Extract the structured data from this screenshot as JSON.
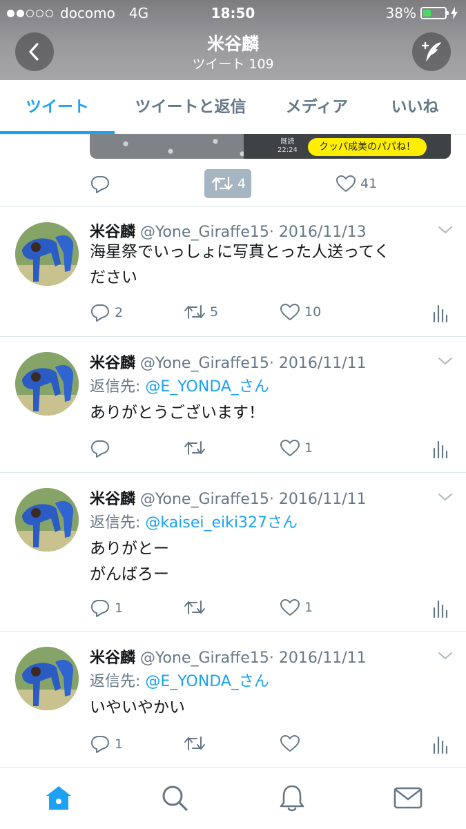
{
  "status_bar": {
    "carrier": "docomo",
    "network": "4G",
    "time": "18:50",
    "battery": "38%",
    "battery_level": 0.38
  },
  "header": {
    "name": "米谷麟",
    "tweet_count": "ツイート 109"
  },
  "tabs": [
    {
      "label": "ツイート",
      "active": true
    },
    {
      "label": "ツイートと返信"
    },
    {
      "label": "メディア"
    },
    {
      "label": "いいね"
    }
  ],
  "partial_tweet": {
    "image_read_mark": "既読",
    "image_time": "22:24",
    "image_bubble": "クッパ成美のパパね！",
    "retweets": "4",
    "likes": "41"
  },
  "tweets": [
    {
      "name": "米谷麟",
      "handle": "@Yone_Giraffe15",
      "date": "· 2016/11/13",
      "text_lines": [
        "海星祭でいっしょに写真とった人送ってく",
        "ださい"
      ],
      "replies": "2",
      "retweets": "5",
      "likes": "10"
    },
    {
      "name": "米谷麟",
      "handle": "@Yone_Giraffe15",
      "date": "· 2016/11/11",
      "reply_label": "返信先: ",
      "reply_handle": "@E_YONDA_さん",
      "text_lines": [
        "ありがとうございます！"
      ],
      "replies": "",
      "retweets": "",
      "likes": "1"
    },
    {
      "name": "米谷麟",
      "handle": "@Yone_Giraffe15",
      "date": "· 2016/11/11",
      "reply_label": "返信先: ",
      "reply_handle": "@kaisei_eiki327さん",
      "text_lines": [
        "ありがとー",
        "がんばろー"
      ],
      "replies": "1",
      "retweets": "",
      "likes": "1"
    },
    {
      "name": "米谷麟",
      "handle": "@Yone_Giraffe15",
      "date": "· 2016/11/11",
      "reply_label": "返信先: ",
      "reply_handle": "@E_YONDA_さん",
      "text_lines": [
        "いやいやかい"
      ],
      "replies": "1",
      "retweets": "",
      "likes": ""
    }
  ],
  "icons": {
    "back": "chevron-left-icon",
    "compose": "compose-icon",
    "reply": "reply-icon",
    "retweet": "retweet-icon",
    "like": "heart-icon",
    "analytics": "analytics-icon",
    "home": "home-icon",
    "search": "search-icon",
    "notifications": "bell-icon",
    "messages": "mail-icon"
  },
  "colors": {
    "accent": "#1da1f2",
    "secondary_text": "#657786",
    "divider": "#e1e8ed"
  }
}
